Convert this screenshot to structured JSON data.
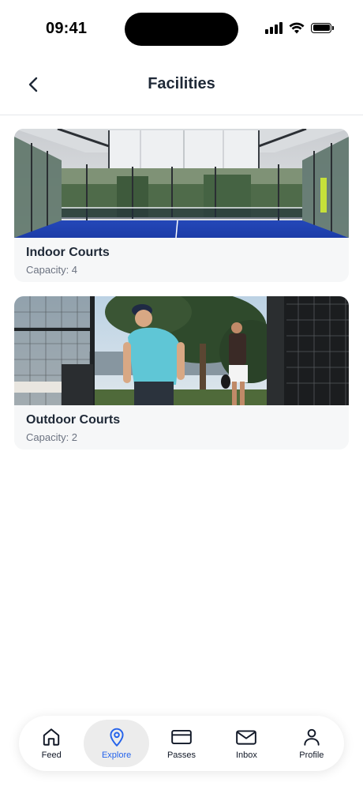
{
  "status_bar": {
    "time": "09:41"
  },
  "header": {
    "title": "Facilities"
  },
  "facilities": [
    {
      "name": "Indoor Courts",
      "capacity": "Capacity: 4"
    },
    {
      "name": "Outdoor Courts",
      "capacity": "Capacity: 2"
    }
  ],
  "nav": {
    "items": [
      {
        "label": "Feed",
        "icon": "home-icon"
      },
      {
        "label": "Explore",
        "icon": "map-pin-icon",
        "active": true
      },
      {
        "label": "Passes",
        "icon": "card-icon"
      },
      {
        "label": "Inbox",
        "icon": "mail-icon"
      },
      {
        "label": "Profile",
        "icon": "user-icon"
      }
    ],
    "active_color": "#2563eb"
  }
}
